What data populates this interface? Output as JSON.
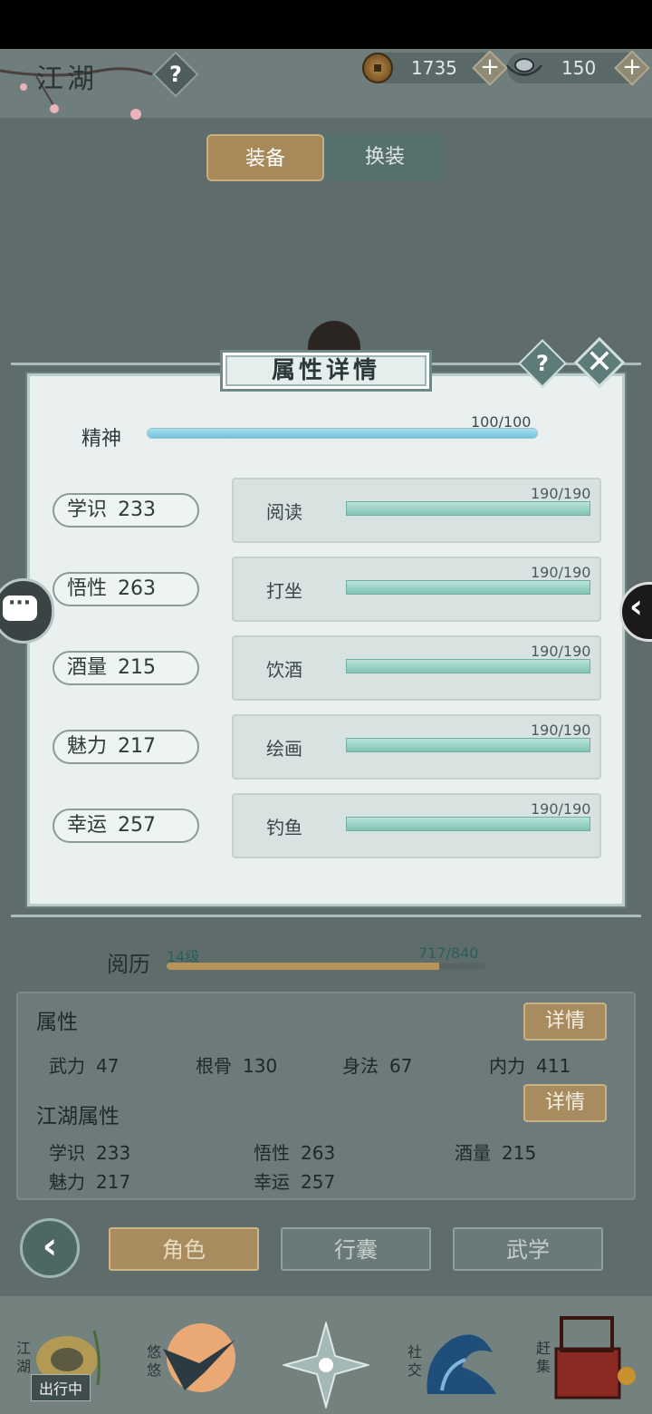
{
  "header": {
    "title": "江湖",
    "help": "?",
    "copper": "1735",
    "silver": "150",
    "plus": "+"
  },
  "tabs": [
    {
      "label": "装备",
      "active": true
    },
    {
      "label": "换装",
      "active": false
    }
  ],
  "dialog": {
    "title": "属性详情",
    "help": "?",
    "close": "✕",
    "spirit": {
      "label": "精神",
      "value": "100/100",
      "fraction": 1.0
    },
    "attributes": [
      {
        "name": "学识",
        "value": "233",
        "skill": "阅读",
        "progress": "190/190",
        "fraction": 1.0
      },
      {
        "name": "悟性",
        "value": "263",
        "skill": "打坐",
        "progress": "190/190",
        "fraction": 1.0
      },
      {
        "name": "酒量",
        "value": "215",
        "skill": "饮酒",
        "progress": "190/190",
        "fraction": 1.0
      },
      {
        "name": "魅力",
        "value": "217",
        "skill": "绘画",
        "progress": "190/190",
        "fraction": 1.0
      },
      {
        "name": "幸运",
        "value": "257",
        "skill": "钓鱼",
        "progress": "190/190",
        "fraction": 1.0
      }
    ]
  },
  "experience": {
    "label": "阅历",
    "level": "14级",
    "value": "717/840",
    "fraction": 0.854
  },
  "attributes_panel": {
    "title": "属性",
    "detail": "详情",
    "stats": [
      {
        "name": "武力",
        "value": "47"
      },
      {
        "name": "根骨",
        "value": "130"
      },
      {
        "name": "身法",
        "value": "67"
      },
      {
        "name": "内力",
        "value": "411"
      }
    ]
  },
  "jianghu_panel": {
    "title": "江湖属性",
    "detail": "详情",
    "stats": [
      {
        "name": "学识",
        "value": "233"
      },
      {
        "name": "悟性",
        "value": "263"
      },
      {
        "name": "酒量",
        "value": "215"
      },
      {
        "name": "魅力",
        "value": "217"
      },
      {
        "name": "幸运",
        "value": "257"
      }
    ]
  },
  "nav": {
    "back": "‹",
    "buttons": [
      {
        "label": "角色",
        "active": true
      },
      {
        "label": "行囊",
        "active": false
      },
      {
        "label": "武学",
        "active": false
      }
    ]
  },
  "dock": {
    "jianghu": "江湖",
    "status": "出行中",
    "youyou": "悠悠",
    "social": "社交",
    "market": "赶集"
  },
  "colors": {
    "accent_gold": "#a88c5f",
    "dialog_bg": "#e9f0ef",
    "bar_teal": "#82c3b5",
    "spirit_blue": "#6fc4de"
  }
}
